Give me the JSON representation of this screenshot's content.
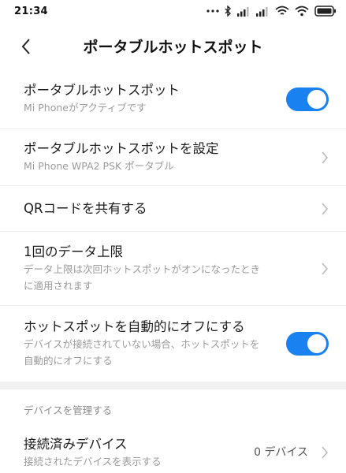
{
  "status_bar": {
    "time": "21:34",
    "icons": [
      "more-dots-icon",
      "bluetooth-icon",
      "signal-icon",
      "signal-icon",
      "wifi-icon",
      "hotspot-icon",
      "battery-icon"
    ]
  },
  "header": {
    "title": "ポータブルホットスポット",
    "back_icon": "chevron-left-icon"
  },
  "settings": {
    "hotspot_toggle": {
      "title": "ポータブルホットスポット",
      "subtitle": "Mi Phoneがアクティブです",
      "enabled": true
    },
    "configure": {
      "title": "ポータブルホットスポットを設定",
      "subtitle": "Mi Phone WPA2 PSK ポータブル"
    },
    "share_qr": {
      "title": "QRコードを共有する"
    },
    "data_limit": {
      "title": "1回のデータ上限",
      "subtitle": "データ上限は次回ホットスポットがオンになったときに適用されます"
    },
    "auto_off": {
      "title": "ホットスポットを自動的にオフにする",
      "subtitle": "デバイスが接続されていない場合、ホットスポットを自動的にオフにする",
      "enabled": true
    }
  },
  "manage_devices": {
    "section_title": "デバイスを管理する",
    "connected": {
      "title": "接続済みデバイス",
      "subtitle": "接続されたデバイスを表示する",
      "value": "0 デバイス"
    }
  },
  "colors": {
    "accent": "#1a82f0",
    "subtitle": "#9a9a9a",
    "divider": "#eeeeee"
  }
}
